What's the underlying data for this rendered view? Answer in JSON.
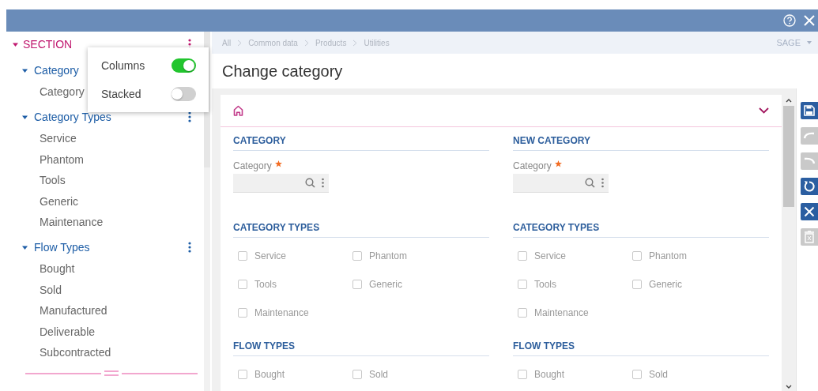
{
  "breadcrumb": [
    "All",
    "Common data",
    "Products",
    "Utilities"
  ],
  "user": "SAGE",
  "page_title": "Change category",
  "sidebar": {
    "section": {
      "label": "SECTION",
      "expanded": true
    },
    "groups": [
      {
        "label": "Category",
        "expanded": true,
        "items": [
          "Category"
        ]
      },
      {
        "label": "Category Types",
        "expanded": true,
        "items": [
          "Service",
          "Phantom",
          "Tools",
          "Generic",
          "Maintenance"
        ]
      },
      {
        "label": "Flow Types",
        "expanded": true,
        "items": [
          "Bought",
          "Sold",
          "Manufactured",
          "Deliverable",
          "Subcontracted"
        ]
      }
    ]
  },
  "popup": {
    "options": [
      {
        "label": "Columns",
        "on": true
      },
      {
        "label": "Stacked",
        "on": false
      }
    ]
  },
  "form": {
    "columns": [
      {
        "title": "CATEGORY",
        "field": {
          "label": "Category",
          "required": true
        },
        "groups": [
          {
            "title": "CATEGORY TYPES",
            "options": [
              {
                "label": "Service",
                "checked": false
              },
              {
                "label": "Phantom",
                "checked": false
              },
              {
                "label": "Tools",
                "checked": false
              },
              {
                "label": "Generic",
                "checked": false
              },
              {
                "label": "Maintenance",
                "checked": false
              }
            ]
          },
          {
            "title": "FLOW TYPES",
            "options": [
              {
                "label": "Bought",
                "checked": false
              },
              {
                "label": "Sold",
                "checked": false
              }
            ]
          }
        ]
      },
      {
        "title": "NEW CATEGORY",
        "field": {
          "label": "Category",
          "required": true
        },
        "groups": [
          {
            "title": "CATEGORY TYPES",
            "options": [
              {
                "label": "Service",
                "checked": false
              },
              {
                "label": "Phantom",
                "checked": false
              },
              {
                "label": "Tools",
                "checked": false
              },
              {
                "label": "Generic",
                "checked": false
              },
              {
                "label": "Maintenance",
                "checked": false
              }
            ]
          },
          {
            "title": "FLOW TYPES",
            "options": [
              {
                "label": "Bought",
                "checked": false
              },
              {
                "label": "Sold",
                "checked": false
              }
            ]
          }
        ]
      }
    ]
  },
  "toolbar": [
    {
      "kind": "save",
      "disabled": false
    },
    {
      "kind": "undo",
      "disabled": true
    },
    {
      "kind": "redo",
      "disabled": true
    },
    {
      "kind": "refresh",
      "disabled": false
    },
    {
      "kind": "close",
      "disabled": false
    },
    {
      "kind": "delete",
      "disabled": true
    }
  ]
}
